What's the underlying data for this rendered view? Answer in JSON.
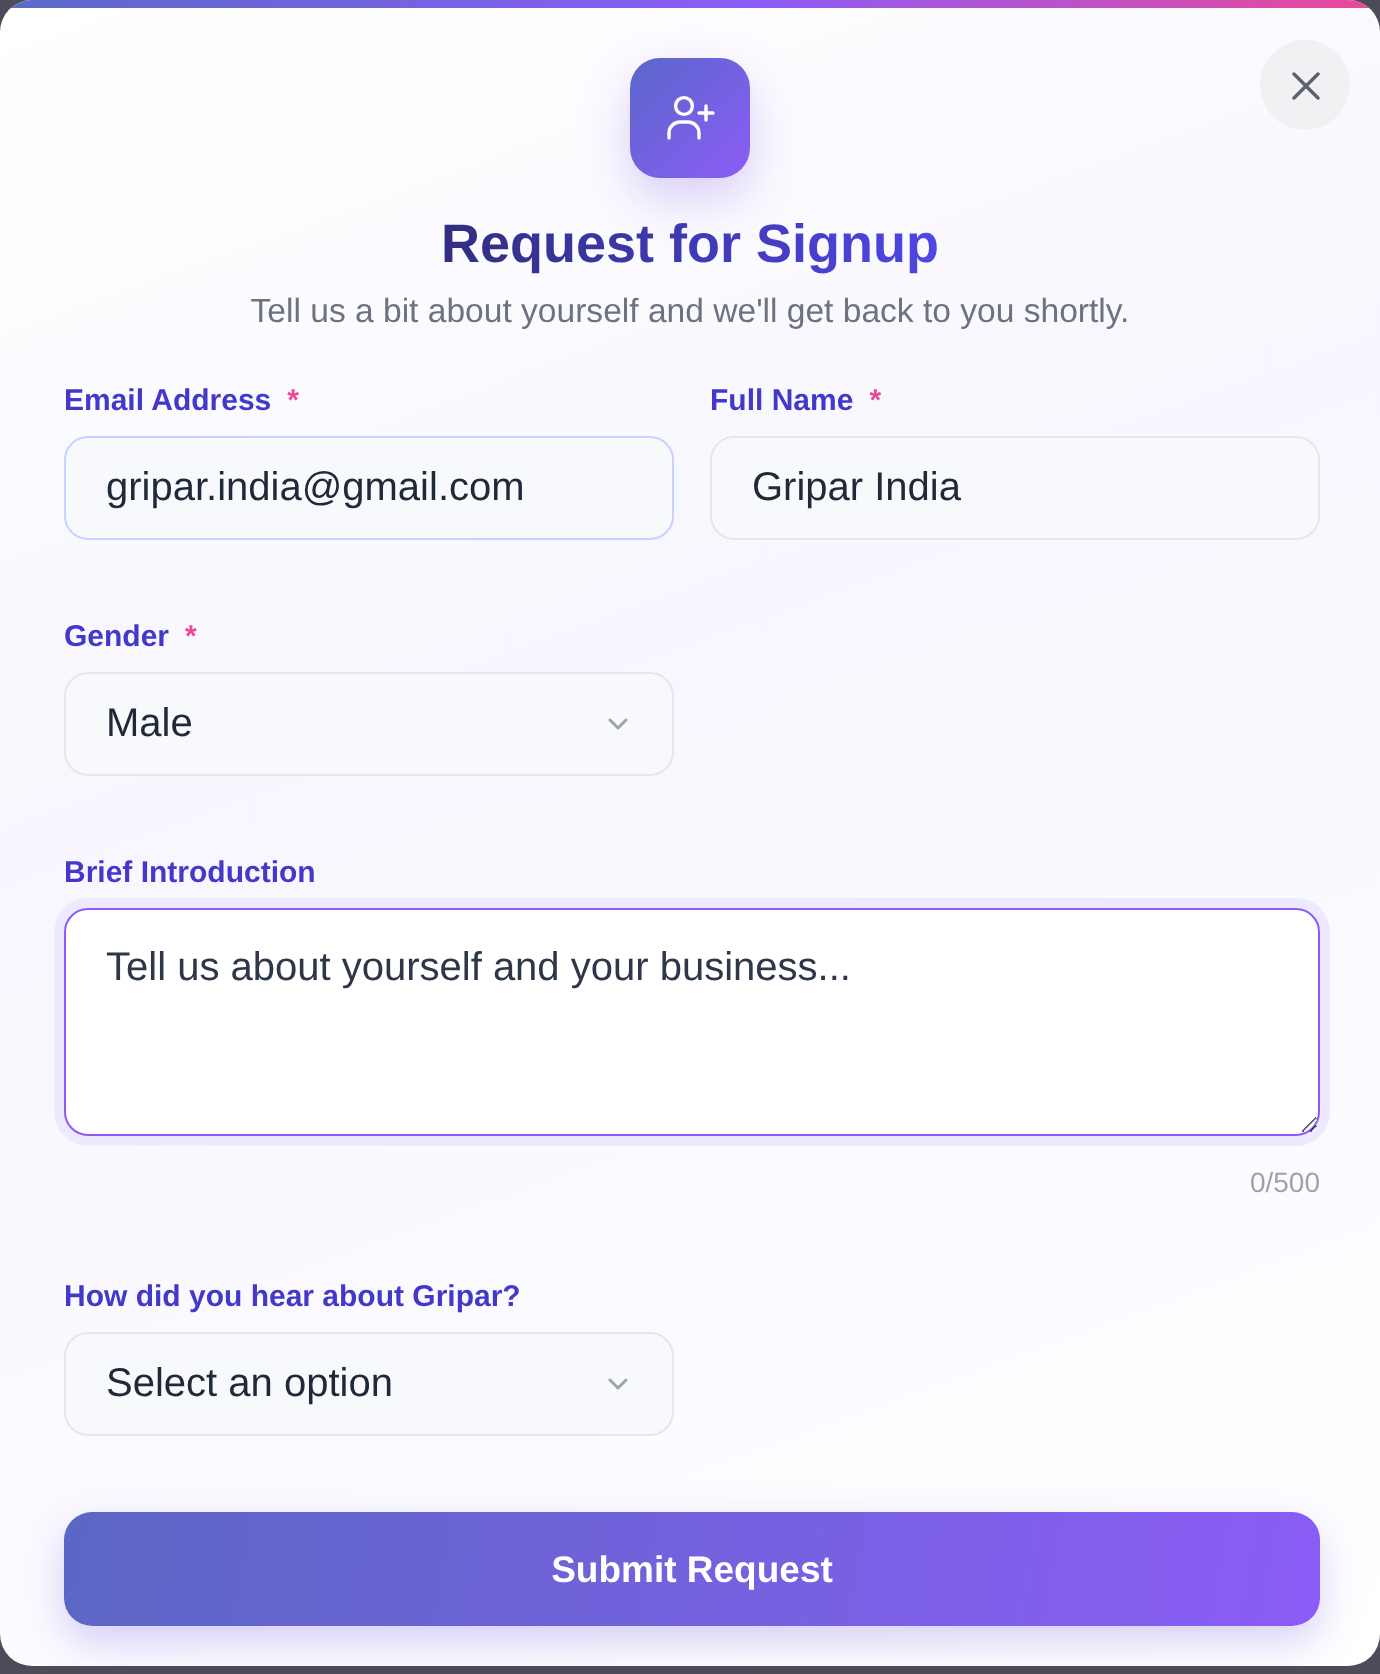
{
  "header": {
    "title": "Request for Signup",
    "subtitle": "Tell us a bit about yourself and we'll get back to you shortly."
  },
  "form_rows": [
    [
      {
        "kind": "text",
        "label": "Email Address",
        "required_mark": "*",
        "value": "gripar.india@gmail.com",
        "hovered": true,
        "focused": false
      },
      {
        "kind": "text",
        "label": "Full Name",
        "required_mark": "*",
        "value": "Gripar India",
        "hovered": false,
        "focused": false
      }
    ],
    [
      {
        "kind": "select",
        "label": "Gender",
        "required_mark": "*",
        "value": "Male",
        "hovered": false,
        "focused": false
      }
    ],
    [
      {
        "kind": "textarea",
        "label": "Brief Introduction",
        "placeholder": "Tell us about yourself and your business...",
        "counter": "0/500",
        "hovered": false,
        "focused": true
      }
    ],
    [
      {
        "kind": "select",
        "label": "How did you hear about Gripar?",
        "value": "Select an option",
        "hovered": false,
        "focused": false
      }
    ]
  ],
  "submit_button": {
    "label": "Submit Request"
  }
}
